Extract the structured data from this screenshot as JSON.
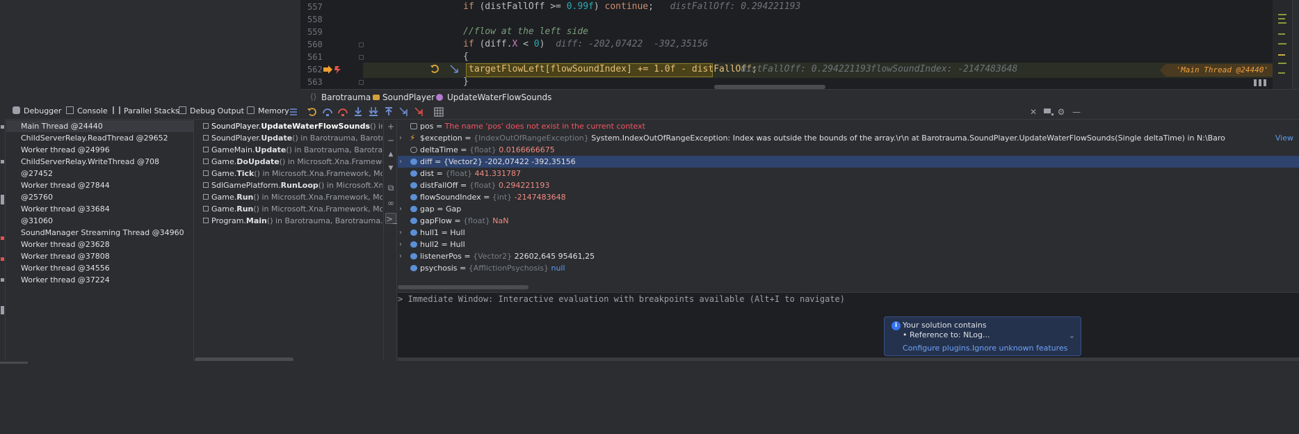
{
  "editor": {
    "lines": [
      {
        "number": "557"
      },
      {
        "number": "558"
      },
      {
        "number": "559"
      },
      {
        "number": "560"
      },
      {
        "number": "561"
      },
      {
        "number": "562"
      },
      {
        "number": "563"
      }
    ],
    "line557": {
      "kw_if": "if",
      "open": " (distFallOff >= ",
      "lit": "0.99f",
      "close": ") ",
      "kw_continue": "continue",
      "semi": ";",
      "inline": "distFallOff: 0.294221193"
    },
    "line559": {
      "comment": "//flow at the left side"
    },
    "line560": {
      "kw_if": "if",
      "open": " (diff.",
      "field": "X",
      "mid": " < ",
      "lit": "0",
      "close": ")",
      "inline": "diff: -202,07422  -392,35156"
    },
    "line561": {
      "brace": "{"
    },
    "line562": {
      "code_a": "targetFlowLeft[flowSoundIndex] += ",
      "lit": "1.0f",
      "code_b": " - distFallOff;",
      "inline1": "distFallOff: 0.294221193",
      "inline2": "flowSoundIndex: -2147483648",
      "thread_tag": "'Main Thread @24440'"
    },
    "line563": {
      "brace": "}"
    }
  },
  "breadcrumb": {
    "items": [
      "Barotrauma",
      "SoundPlayer",
      "UpdateWaterFlowSounds"
    ]
  },
  "debug_toolbar": {
    "tabs": [
      {
        "label": "Debugger",
        "icon": "bug-icon"
      },
      {
        "label": "Console",
        "icon": "console-icon"
      },
      {
        "label": "Parallel Stacks",
        "icon": "parallel-stacks-icon"
      },
      {
        "label": "Debug Output",
        "icon": "debug-output-icon"
      },
      {
        "label": "Memory",
        "icon": "memory-icon"
      }
    ]
  },
  "threads": [
    {
      "label": "Main Thread @24440",
      "selected": true
    },
    {
      "label": "ChildServerRelay.ReadThread @29652"
    },
    {
      "label": "Worker thread @24996"
    },
    {
      "label": "ChildServerRelay.WriteThread @708"
    },
    {
      "label": " @27452"
    },
    {
      "label": "Worker thread @27844"
    },
    {
      "label": " @25760"
    },
    {
      "label": "Worker thread @33684"
    },
    {
      "label": " @31060"
    },
    {
      "label": "SoundManager Streaming Thread @34960"
    },
    {
      "label": "Worker thread @23628"
    },
    {
      "label": "Worker thread @37808"
    },
    {
      "label": "Worker thread @34556"
    },
    {
      "label": "Worker thread @37224"
    }
  ],
  "frames": [
    {
      "cls": "SoundPlayer.",
      "method": "UpdateWaterFlowSounds",
      "rest": "() in Barotrauma",
      "selected": true
    },
    {
      "cls": "SoundPlayer.",
      "method": "Update",
      "rest": "() in Barotrauma, Barotrauma.dll"
    },
    {
      "cls": "GameMain.",
      "method": "Update",
      "rest": "() in Barotrauma, Barotrauma.dll"
    },
    {
      "cls": "Game.",
      "method": "DoUpdate",
      "rest": "() in Microsoft.Xna.Framework, MonoG"
    },
    {
      "cls": "Game.",
      "method": "Tick",
      "rest": "() in Microsoft.Xna.Framework, MonoGame.F"
    },
    {
      "cls": "SdlGamePlatform.",
      "method": "RunLoop",
      "rest": "() in Microsoft.Xna.Framew"
    },
    {
      "cls": "Game.",
      "method": "Run",
      "rest": "() in Microsoft.Xna.Framework, MonoGame.F"
    },
    {
      "cls": "Game.",
      "method": "Run",
      "rest": "() in Microsoft.Xna.Framework, MonoGame.F"
    },
    {
      "cls": "Program.",
      "method": "Main",
      "rest": "() in Barotrauma, Barotrauma.dll"
    }
  ],
  "variables": [
    {
      "name": "pos",
      "eq": " = ",
      "type": "",
      "value": "The name 'pos' does not exist in the current context",
      "kind": "err",
      "expandable": false
    },
    {
      "name": "$exception",
      "eq": " = ",
      "type": "{IndexOutOfRangeException} ",
      "value": "System.IndexOutOfRangeException: Index was outside the bounds of the array.\\r\\n   at Barotrauma.SoundPlayer.UpdateWaterFlowSounds(Single deltaTime) in N:\\Baro",
      "kind": "plain",
      "expandable": true,
      "link": "View"
    },
    {
      "name": "deltaTime",
      "eq": " = ",
      "type": "{float} ",
      "value": "0.0166666675",
      "kind": "num",
      "expandable": false
    },
    {
      "name": "diff",
      "eq": " = ",
      "type": "{Vector2} ",
      "value": "-202,07422  -392,35156",
      "kind": "plain",
      "expandable": true,
      "selected": true
    },
    {
      "name": "dist",
      "eq": " = ",
      "type": "{float} ",
      "value": "441.331787",
      "kind": "num",
      "expandable": false
    },
    {
      "name": "distFallOff",
      "eq": " = ",
      "type": "{float} ",
      "value": "0.294221193",
      "kind": "num",
      "expandable": false
    },
    {
      "name": "flowSoundIndex",
      "eq": " = ",
      "type": "{int} ",
      "value": "-2147483648",
      "kind": "num",
      "expandable": false
    },
    {
      "name": "gap",
      "eq": " = ",
      "type": "",
      "value": "Gap",
      "kind": "plain",
      "expandable": true
    },
    {
      "name": "gapFlow",
      "eq": " = ",
      "type": "{float} ",
      "value": "NaN",
      "kind": "num",
      "expandable": false
    },
    {
      "name": "hull1",
      "eq": " = ",
      "type": "",
      "value": "Hull",
      "kind": "plain",
      "expandable": true
    },
    {
      "name": "hull2",
      "eq": " = ",
      "type": "",
      "value": "Hull",
      "kind": "plain",
      "expandable": true
    },
    {
      "name": "listenerPos",
      "eq": " = ",
      "type": "{Vector2} ",
      "value": "22602,645  95461,25",
      "kind": "plain",
      "expandable": true
    },
    {
      "name": "psychosis",
      "eq": " = ",
      "type": "{AfflictionPsychosis} ",
      "value": "null",
      "kind": "null",
      "expandable": false
    }
  ],
  "immediate": {
    "placeholder": "> Immediate Window: Interactive evaluation with breakpoints available (Alt+I to navigate)"
  },
  "notification": {
    "title": "Your solution contains",
    "detail": "• Reference to: NLog...",
    "action1": "Configure plugins...",
    "action2": "Ignore unknown features"
  },
  "colors": {
    "accent": "#3574f0",
    "selection": "#2e436e",
    "error": "#f75464",
    "number": "#f28b82",
    "exec_line": "#4a4218"
  }
}
